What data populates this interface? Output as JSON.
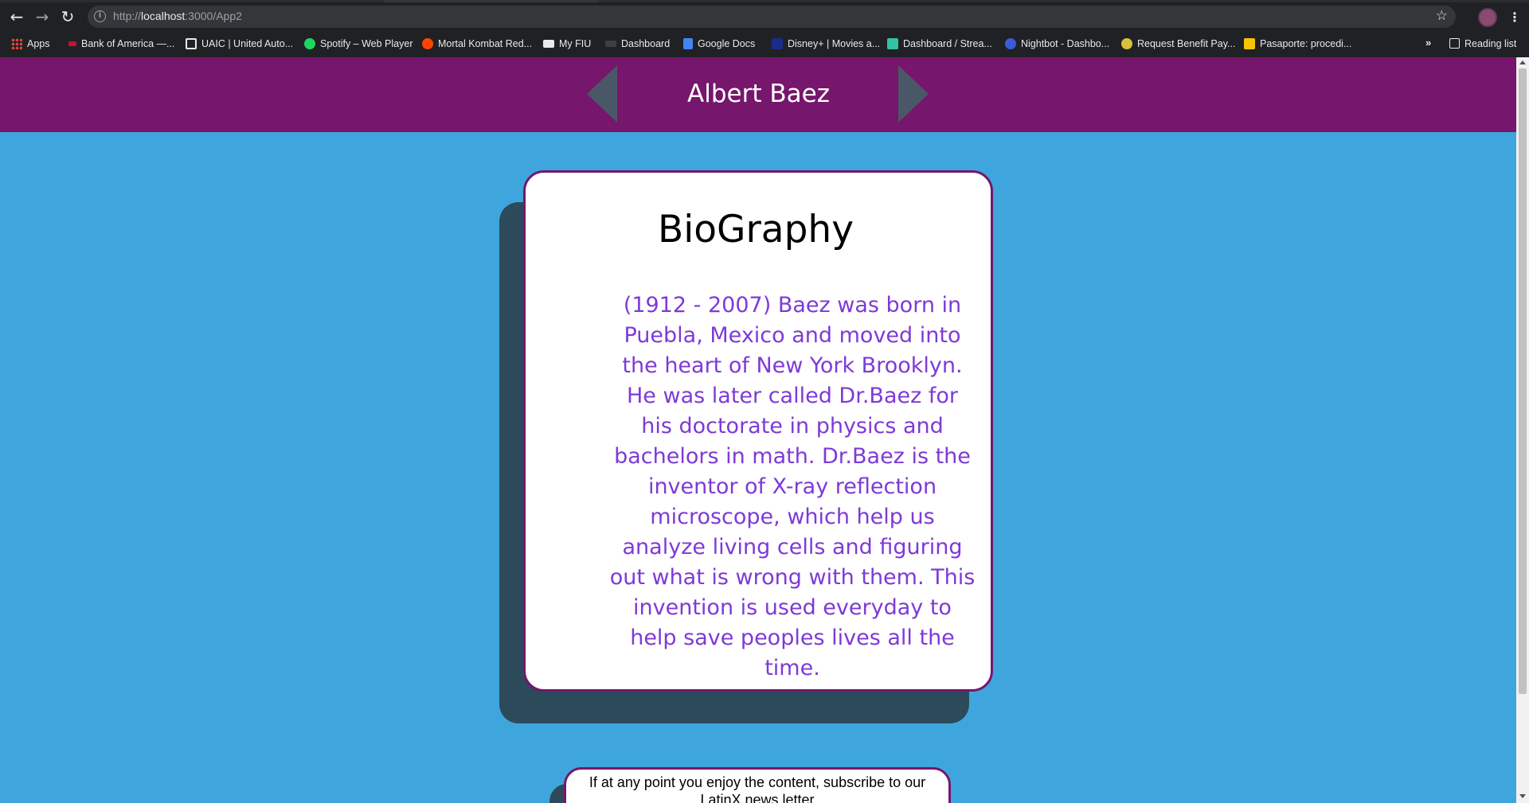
{
  "browser": {
    "url_prefix": "http://",
    "url_host": "localhost",
    "url_rest": ":3000/App2",
    "back_glyph": "←",
    "forward_glyph": "→",
    "reload_glyph": "↻",
    "star_glyph": "☆",
    "menu_glyph": "⋮",
    "more_glyph": "»",
    "bookmarks": [
      {
        "label": "Apps",
        "icon": "apps-grid-icon",
        "color": "#ea4335"
      },
      {
        "label": "Bank of America —...",
        "icon": "bank-icon",
        "color": "#c41230"
      },
      {
        "label": "UAIC | United Auto...",
        "icon": "uaic-icon",
        "color": "#e8eaed"
      },
      {
        "label": "Spotify – Web Player",
        "icon": "spotify-icon",
        "color": "#1ed760"
      },
      {
        "label": "Mortal Kombat Red...",
        "icon": "reddit-icon",
        "color": "#ff4500"
      },
      {
        "label": "My FIU",
        "icon": "fiu-icon",
        "color": "#e8eaed"
      },
      {
        "label": "Dashboard",
        "icon": "dashboard-icon",
        "color": "#3c4043"
      },
      {
        "label": "Google Docs",
        "icon": "docs-icon",
        "color": "#4285f4"
      },
      {
        "label": "Disney+ | Movies a...",
        "icon": "disney-icon",
        "color": "#1a2b8c"
      },
      {
        "label": "Dashboard / Strea...",
        "icon": "streamlabs-icon",
        "color": "#31c3a2"
      },
      {
        "label": "Nightbot - Dashbo...",
        "icon": "nightbot-icon",
        "color": "#3a5bd9"
      },
      {
        "label": "Request Benefit Pay...",
        "icon": "benefit-icon",
        "color": "#d7c23a"
      },
      {
        "label": "Pasaporte: procedi...",
        "icon": "pasaporte-icon",
        "color": "#f6c500"
      }
    ],
    "reading_list": "Reading list"
  },
  "header": {
    "title": "Albert Baez"
  },
  "bio": {
    "title": "BioGraphy",
    "text": "(1912 - 2007) Baez was born in Puebla, Mexico and moved into the heart of New York Brooklyn. He was later called Dr.Baez for his doctorate in physics and bachelors in math. Dr.Baez is the inventor of X-ray reflection microscope, which help us analyze living cells and figuring out what is wrong with them. This invention is used everyday to help save peoples lives all the time."
  },
  "subscribe": {
    "text": "If at any point you enjoy the content, subscribe to our LatinX news letter"
  },
  "colors": {
    "header_bg": "#76166c",
    "page_bg": "#3ea6dd",
    "bio_text": "#7e3ad6",
    "arrow": "#4a5766",
    "shadow": "#2d4a5b"
  }
}
